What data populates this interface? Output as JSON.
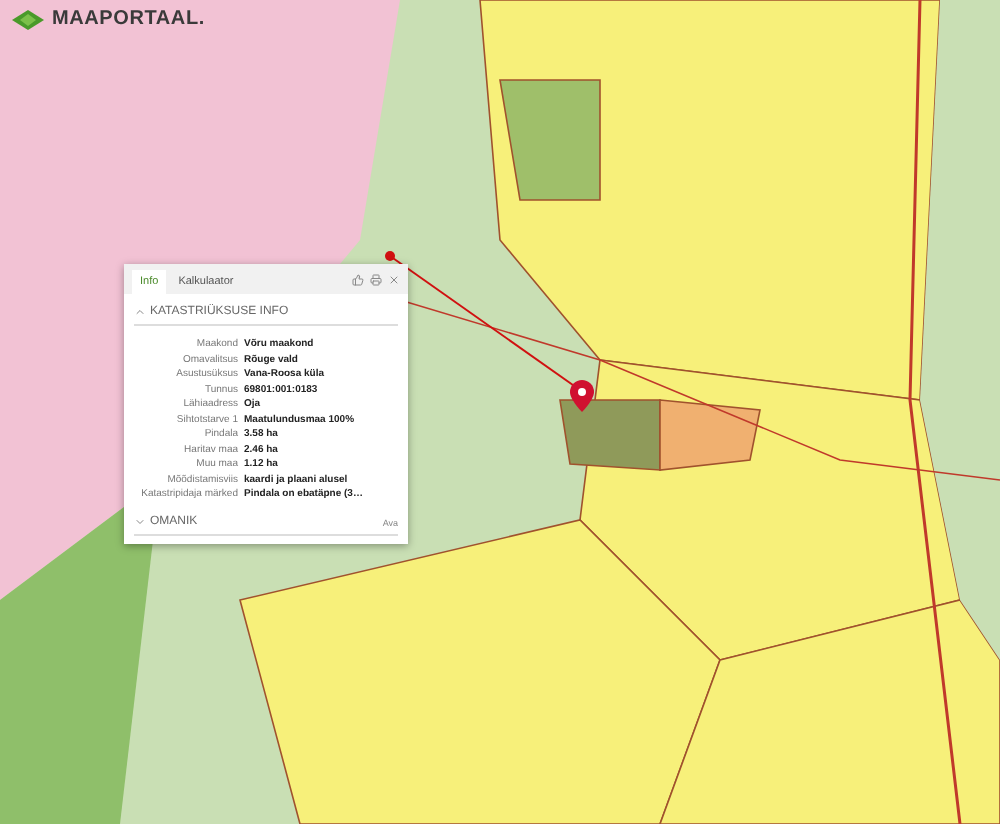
{
  "logo": {
    "text": "MAAPORTAAL."
  },
  "popup": {
    "tabs": [
      {
        "label": "Info",
        "selected": true
      },
      {
        "label": "Kalkulaator",
        "selected": false
      }
    ],
    "sections": [
      {
        "title": "KATASTRIÜKSUSE INFO",
        "expanded": true,
        "rows": [
          {
            "label": "Maakond",
            "value": "Võru maakond"
          },
          {
            "label": "Omavalitsus",
            "value": "Rõuge vald"
          },
          {
            "label": "Asustusüksus",
            "value": "Vana-Roosa küla"
          },
          {
            "label": "Tunnus",
            "value": "69801:001:0183"
          },
          {
            "label": "Lähiaadress",
            "value": "Oja"
          },
          {
            "label": "Sihtotstarve 1",
            "value": "Maatulundusmaa 100%"
          },
          {
            "label": "Pindala",
            "value": "3.58 ha"
          },
          {
            "label": "Haritav maa",
            "value": "2.46 ha"
          },
          {
            "label": "Muu maa",
            "value": "1.12 ha"
          },
          {
            "label": "Mõõdistamisviis",
            "value": "kaardi ja plaani alusel"
          },
          {
            "label": "Katastripidaja märked",
            "value": "Pindala on ebatäpne (3…"
          }
        ]
      },
      {
        "title": "OMANIK",
        "expanded": false,
        "action": "Ava"
      }
    ]
  }
}
